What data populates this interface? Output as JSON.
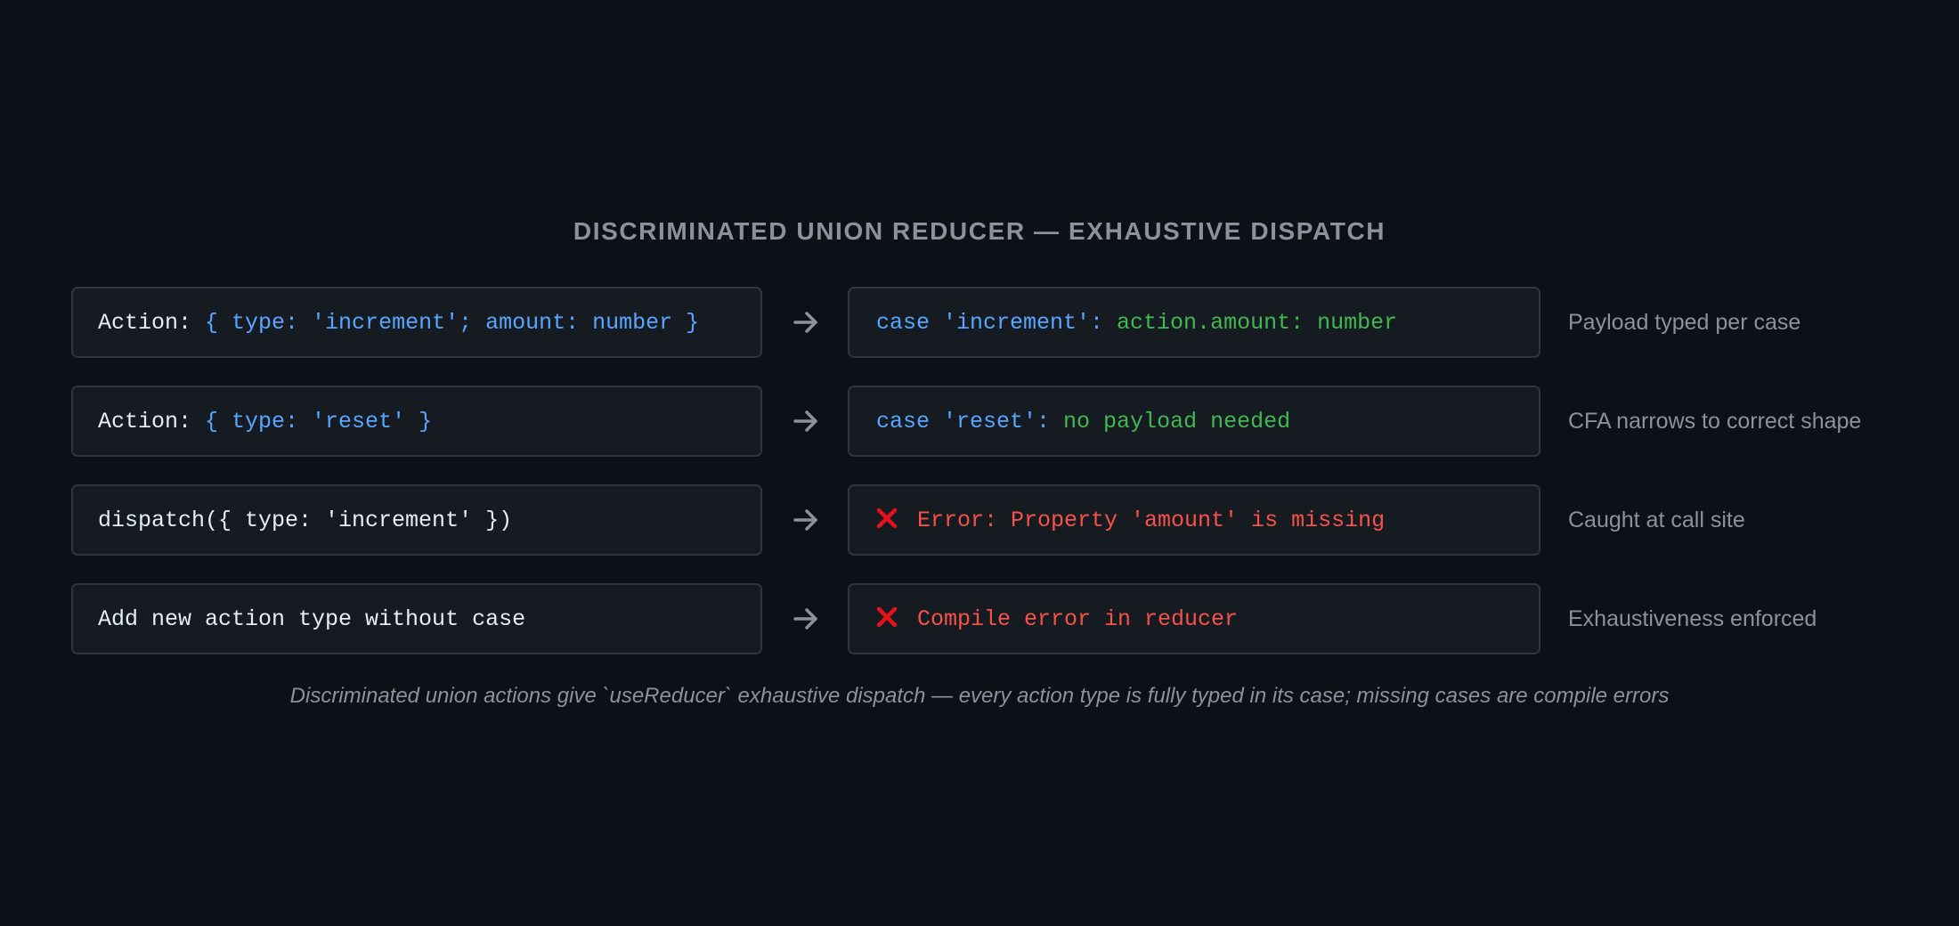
{
  "title": "DISCRIMINATED UNION REDUCER — EXHAUSTIVE DISPATCH",
  "rows": [
    {
      "left": {
        "prefix": "Action: ",
        "code": "{ type: 'increment'; amount: number }"
      },
      "right": {
        "case": "case 'increment': ",
        "detail": "action.amount: number"
      },
      "note": "Payload typed per case"
    },
    {
      "left": {
        "prefix": "Action: ",
        "code": "{ type: 'reset' }"
      },
      "right": {
        "case": "case 'reset': ",
        "detail": "no payload needed"
      },
      "note": "CFA narrows to correct shape"
    },
    {
      "left": {
        "text": "dispatch({ type: 'increment' })"
      },
      "right": {
        "error": "Error: Property 'amount' is missing"
      },
      "note": "Caught at call site"
    },
    {
      "left": {
        "text": "Add new action type without case"
      },
      "right": {
        "error": "Compile error in reducer"
      },
      "note": "Exhaustiveness enforced"
    }
  ],
  "caption": "Discriminated union actions give `useReducer` exhaustive dispatch — every action type is fully typed in its case; missing cases are compile errors",
  "icons": {
    "arrow": "right-arrow-icon",
    "error": "cross-mark-icon"
  },
  "colors": {
    "background": "#0d1117",
    "box": "#161b22",
    "border": "#2f363e",
    "keyword": "#58a6ff",
    "ok": "#3fb950",
    "error": "#f85149",
    "muted": "#8b929b"
  }
}
